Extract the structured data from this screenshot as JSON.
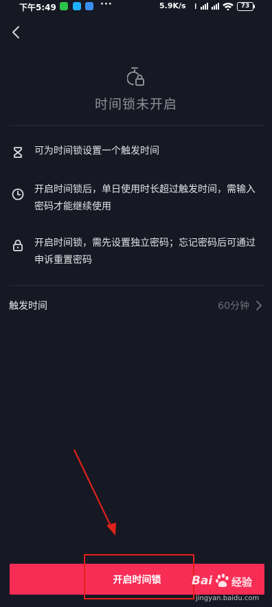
{
  "status_bar": {
    "time": "下午5:49",
    "more": "···",
    "network_speed": "5.9K/s",
    "battery": "73"
  },
  "hero": {
    "icon": "timer-lock-icon",
    "title": "时间锁未开启"
  },
  "info_items": [
    {
      "icon": "hourglass-icon",
      "text": "可为时间锁设置一个触发时间"
    },
    {
      "icon": "clock-icon",
      "text": "开启时间锁后，单日使用时长超过触发时间，需输入密码才能继续使用"
    },
    {
      "icon": "lock-icon",
      "text": "开启时间锁，需先设置独立密码；忘记密码后可通过申诉重置密码"
    }
  ],
  "trigger": {
    "label": "触发时间",
    "value": "60分钟"
  },
  "primary_button": {
    "label": "开启时间锁"
  },
  "watermark": {
    "logo": "Bai",
    "brand": "经验",
    "url": "jingyan.baidu.com"
  },
  "colors": {
    "background": "#161823",
    "accent": "#f72d55",
    "annotation": "#e0221c"
  }
}
